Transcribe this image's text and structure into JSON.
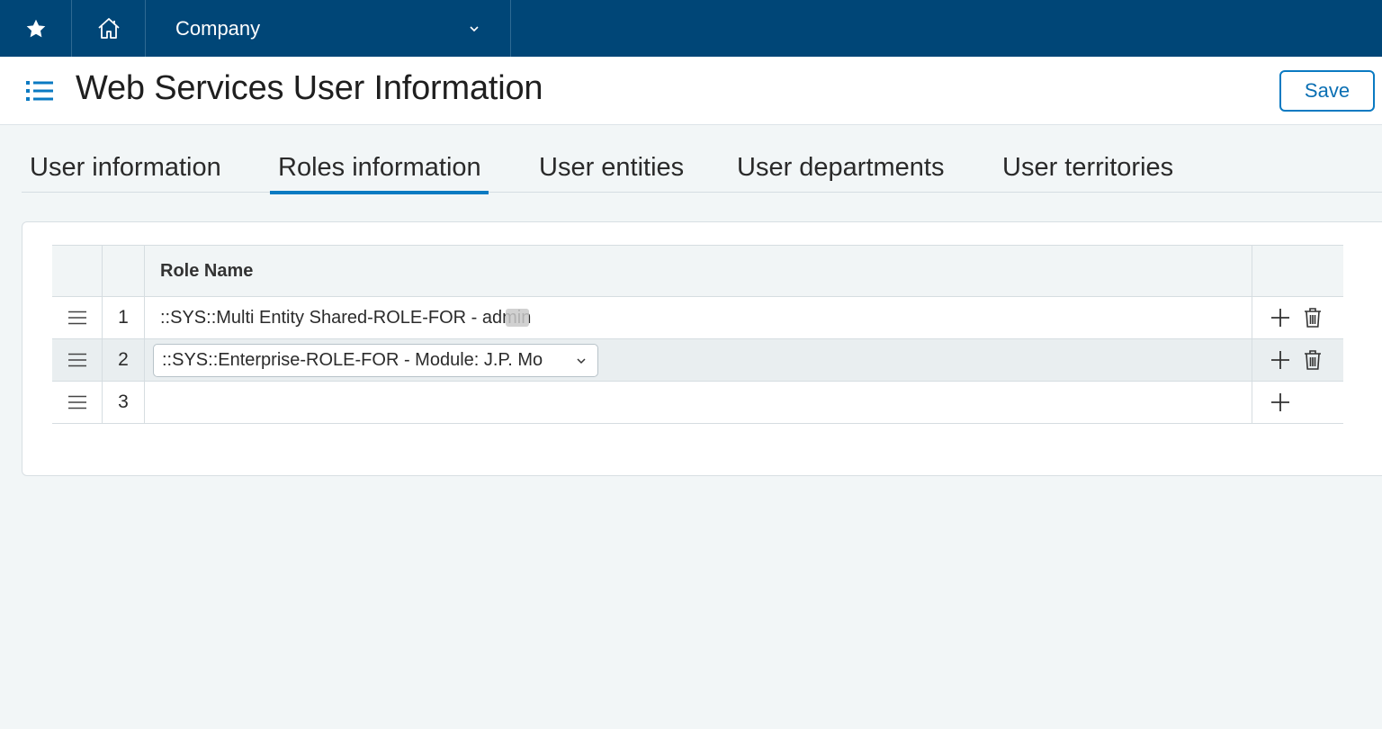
{
  "topbar": {
    "company_label": "Company"
  },
  "header": {
    "title": "Web Services User Information",
    "save_label": "Save"
  },
  "tabs": [
    {
      "label": "User information",
      "active": false
    },
    {
      "label": "Roles information",
      "active": true
    },
    {
      "label": "User entities",
      "active": false
    },
    {
      "label": "User departments",
      "active": false
    },
    {
      "label": "User territories",
      "active": false
    }
  ],
  "grid": {
    "column_header": "Role Name",
    "rows": [
      {
        "num": "1",
        "role": "::SYS::Multi Entity Shared-ROLE-FOR - admin"
      },
      {
        "num": "2",
        "role": "::SYS::Enterprise-ROLE-FOR - Module: J.P. Mo"
      },
      {
        "num": "3",
        "role": ""
      }
    ]
  },
  "colors": {
    "topbar": "#004677",
    "accent": "#0a7ac2",
    "background": "#f2f6f7"
  }
}
